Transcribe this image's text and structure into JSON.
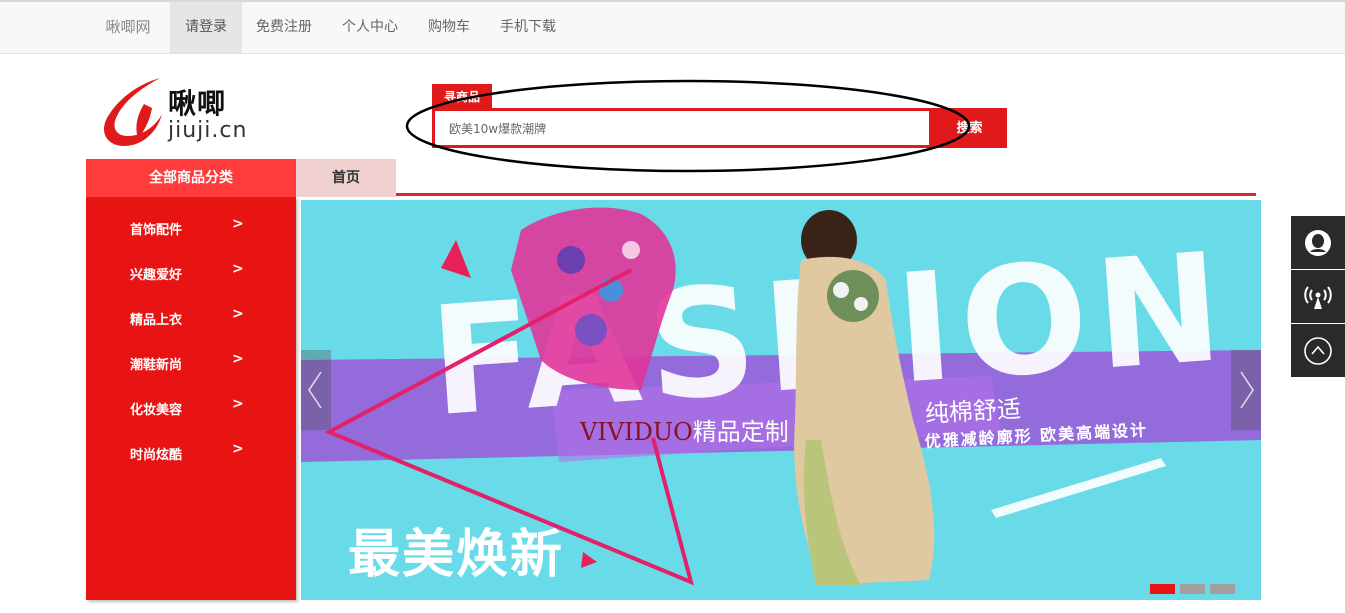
{
  "topnav": {
    "brand": "啾唧网",
    "items": [
      "请登录",
      "免费注册",
      "个人中心",
      "购物车",
      "手机下载"
    ]
  },
  "logo": {
    "name_cn": "啾唧",
    "name_en": "jiuji.cn"
  },
  "search": {
    "tag": "寻商品",
    "value": "欧美10w爆款潮牌",
    "button": "搜索"
  },
  "category_header": "全部商品分类",
  "home_tab": "首页",
  "categories": [
    {
      "label": "首饰配件",
      "arrow": ">"
    },
    {
      "label": "兴趣爱好",
      "arrow": ">"
    },
    {
      "label": "精品上衣",
      "arrow": ">"
    },
    {
      "label": "潮鞋新尚",
      "arrow": ">"
    },
    {
      "label": "化妆美容",
      "arrow": ">"
    },
    {
      "label": "时尚炫酷",
      "arrow": ">"
    }
  ],
  "banner": {
    "headline": "FASHION",
    "brand_line_en": "VIVIDUO",
    "brand_line_cn": "精品定制",
    "cotton_line": "纯棉舒适",
    "sub_line": "优雅减龄廓形 欧美高端设计",
    "big_line": "最美焕新",
    "slides": 3,
    "active_slide": 1
  },
  "colors": {
    "accent_red": "#e81414",
    "banner_bg": "#69dbe8",
    "topbar_bg": "#f8f8f8",
    "tool_bg": "#2a2a2a"
  },
  "side_tools": [
    "qq-icon",
    "wireless-icon",
    "back-to-top-icon"
  ]
}
